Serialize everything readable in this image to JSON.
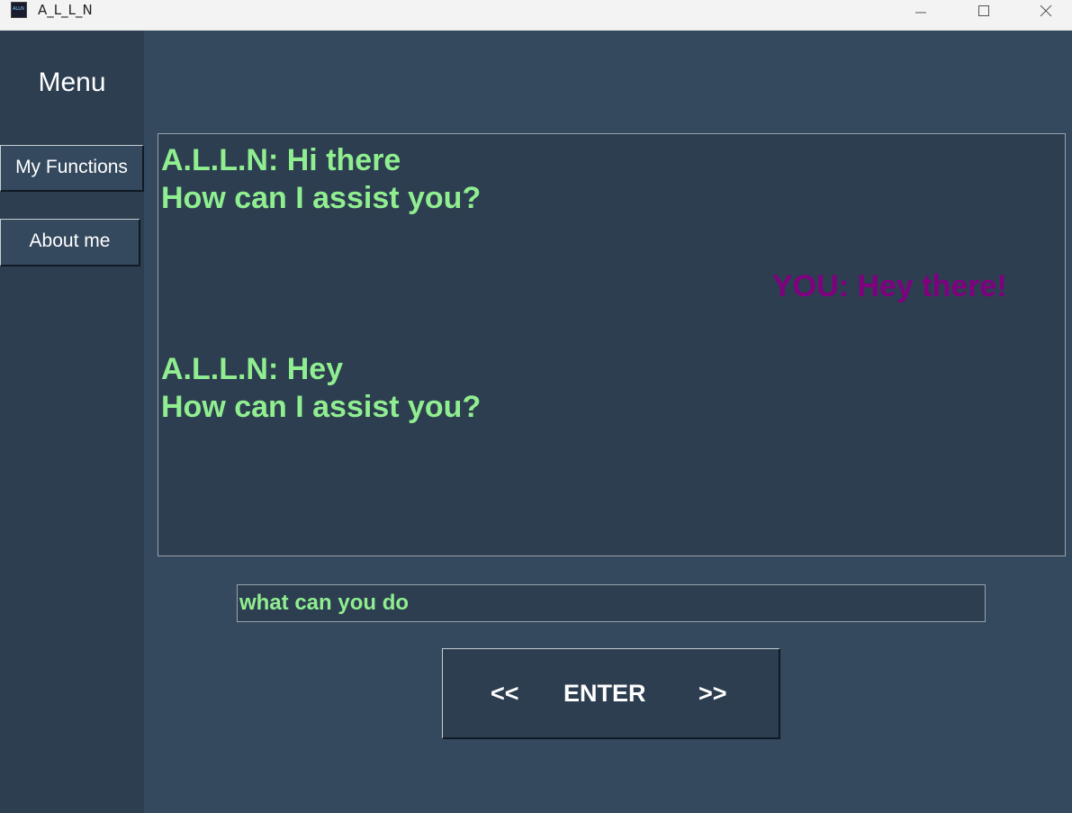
{
  "window": {
    "title": "A_L_L_N",
    "icon_text": "ALLN",
    "controls": [
      "minimize-icon",
      "maximize-icon",
      "close-icon"
    ]
  },
  "sidebar": {
    "title": "Menu",
    "items": [
      {
        "label": "My Functions"
      },
      {
        "label": "About me"
      }
    ]
  },
  "chat": {
    "messages": [
      {
        "sender": "bot",
        "line1": "A.L.L.N: Hi there",
        "line2": "How can I assist you?"
      },
      {
        "sender": "user",
        "text": "YOU: Hey there!"
      },
      {
        "sender": "bot",
        "line1": "A.L.L.N: Hey",
        "line2": "How can I assist you?"
      }
    ]
  },
  "input": {
    "value": "what can you do"
  },
  "enter_button": {
    "left": "<<",
    "label": "ENTER",
    "right": ">>"
  },
  "colors": {
    "background": "#34495e",
    "panel": "#2c3e50",
    "bot_text": "#90ee90",
    "user_text": "#800080",
    "button_text": "#ffffff"
  }
}
